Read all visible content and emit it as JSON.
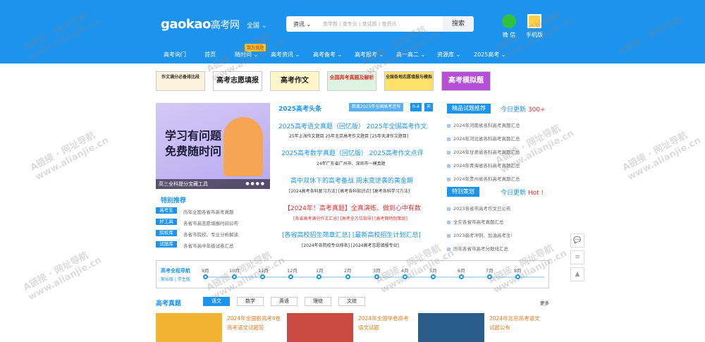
{
  "header": {
    "logo_en": "gaokao",
    "logo_cn": "高考网",
    "region": "全国 ⌄",
    "search_category": "资讯 ⌄",
    "search_placeholder": "查学校 | 查专业 | 查试题 | 查资讯",
    "search_button": "搜索",
    "wechat_label": "微 信",
    "mobile_label": "手机版"
  },
  "nav": {
    "hot_tag": "百万真题",
    "items": [
      "高考询门",
      "首页",
      "随时问 ⌄",
      "高考资讯 ⌄",
      "高考备考 ⌄",
      "高考报考 ⌄",
      "高一高二 ⌄",
      "资源库 ⌄",
      "2025高考 ⌄"
    ]
  },
  "banners": [
    "作文满分必备排比段",
    "高考志愿填报",
    "高考作文",
    "全国高考真题及解析",
    "全国各地志愿填报与模拟",
    "高考模拟题"
  ],
  "hero": {
    "line1": "学习有问题",
    "line2": "免费随时问",
    "caption": "高三全科提分宝藏工具",
    "dots": "● ● ● ●"
  },
  "features": {
    "title": "特别推荐",
    "rows": [
      {
        "tag": "高考生",
        "desc": "历年全国各省市高考真题"
      },
      {
        "tag": "好工具",
        "desc": "各省市高志愿填报时间公布"
      },
      {
        "tag": "院校库",
        "desc": "各省市院校、专业分析解读"
      },
      {
        "tag": "试题库",
        "desc": "各省市高中年级试卷汇总"
      }
    ]
  },
  "headlines": {
    "title": "2025高考头条",
    "countdown": "距离2025年全国高考还有",
    "days": [
      "0-4",
      "天"
    ],
    "items": [
      {
        "main": "2025高考语文真题（回忆版） 2025年全国高考作文",
        "sub": "25年上海作文题目 25年北京高考作文题目 [25年天津作文题目]"
      },
      {
        "main": "2025高考数学真题（回忆版） 2025高考作文点评",
        "sub": "24年广东省广州市、深圳市一模真题"
      },
      {
        "main": "高中双休下的高考备战 周末变逆袭的黄金期",
        "sub": "[2024高考各科复习方法] [高考各科知识点] [高考各科学习方法]"
      },
      {
        "main": "【2024年！高考真题】全真演练、做到心中有数",
        "sub": "[各省高考满分作文汇总] [高考全方位指导] [高考网特别策划]"
      },
      {
        "main": "[各省高校招生简章汇总] [最新高校招生计划汇总]",
        "sub": "[2024年各院校专业排名] [2024高考志愿填报专业]"
      }
    ]
  },
  "side1": {
    "title": "精品试题推荐",
    "update_label": "今日更新",
    "update_value": "300+",
    "items": [
      "2024年河南省各科高考真题汇总",
      "2024年河北省各科高考真题汇总",
      "2024年甘肃省各科高考真题汇总",
      "2024年青海省各科高考真题汇总",
      "2024年贵州省各科高考真题汇总"
    ]
  },
  "side2": {
    "title": "特别策划",
    "update_label": "今日更新",
    "update_value": "Hot !",
    "items": [
      "2023各省市高考作文已公布",
      "全实各省市高考真题汇总",
      "2023高考冲刺、加油高考生!",
      "历年各省市高考分数线汇总"
    ]
  },
  "timeline": {
    "title": "高考全程导航",
    "subtitle": "家长版 | 学生版",
    "months": [
      "9月",
      "10月",
      "11月",
      "12月",
      "1月",
      "2月",
      "3月",
      "4月",
      "5月",
      "6月",
      "7月",
      "8月"
    ]
  },
  "exams": {
    "title": "高考真题",
    "tabs": [
      "语文",
      "数学",
      "英语",
      "理综",
      "文综"
    ],
    "more": "更多",
    "cards": [
      {
        "text": "2024年全国新高考II卷高考语文试题答",
        "color": "#e8a42a"
      },
      {
        "text": "2024年全国甲卷高考语文试题",
        "color": "#c94a3e"
      },
      {
        "text": "2024年北京高考语文试题公布",
        "color": "#2b5d8a"
      }
    ]
  },
  "floating": [
    "💬",
    "≡",
    "▲"
  ],
  "watermark": [
    "A链接 · 网址导航",
    "www.alianjie.cn"
  ],
  "colors": {
    "brand": "#1c94ee",
    "accent_red": "#e03030"
  }
}
